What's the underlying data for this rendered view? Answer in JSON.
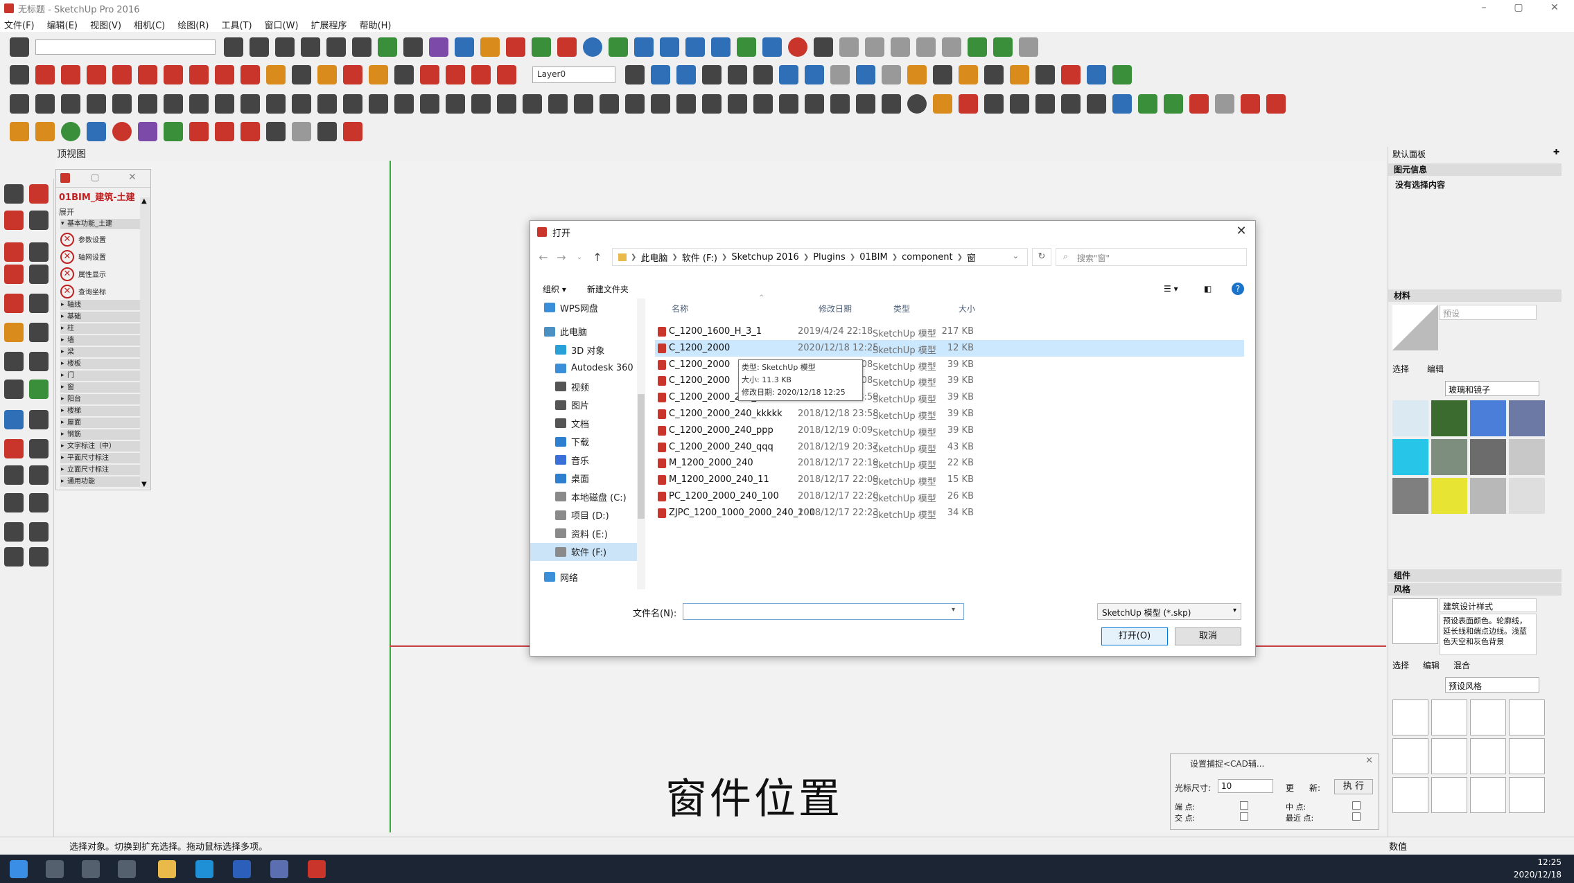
{
  "window": {
    "title": "无标题 - SketchUp Pro 2016"
  },
  "menu": [
    "文件(F)",
    "编辑(E)",
    "视图(V)",
    "相机(C)",
    "绘图(R)",
    "工具(T)",
    "窗口(W)",
    "扩展程序",
    "帮助(H)"
  ],
  "toolbar": {
    "layer_select": "Layer0"
  },
  "view": {
    "label": "顶视图",
    "caption": "窗件位置"
  },
  "plugin_panel": {
    "title": "01BIM_建筑-土建",
    "expand_label": "展开",
    "open_section": "基本功能_土建",
    "items": [
      "参数设置",
      "轴网设置",
      "属性显示",
      "查询坐标"
    ],
    "sections": [
      "轴线",
      "基础",
      "柱",
      "墙",
      "梁",
      "楼板",
      "门",
      "窗",
      "阳台",
      "楼梯",
      "屋面",
      "钢筋",
      "文字标注（中）",
      "平面尺寸标注",
      "立面尺寸标注",
      "通用功能"
    ]
  },
  "dialog": {
    "title": "打开",
    "breadcrumb": [
      "此电脑",
      "软件 (F:)",
      "Sketchup 2016",
      "Plugins",
      "01BIM",
      "component",
      "窗"
    ],
    "search_placeholder": "搜索\"窗\"",
    "organize": "组织 ▾",
    "new_folder": "新建文件夹",
    "nav": [
      {
        "label": "WPS网盘",
        "icon": "cloud-icon"
      },
      {
        "label": "此电脑",
        "icon": "computer-icon"
      },
      {
        "label": "3D 对象",
        "icon": "cube-icon"
      },
      {
        "label": "Autodesk 360",
        "icon": "cloud-icon"
      },
      {
        "label": "视频",
        "icon": "video-icon"
      },
      {
        "label": "图片",
        "icon": "picture-icon"
      },
      {
        "label": "文档",
        "icon": "document-icon"
      },
      {
        "label": "下载",
        "icon": "download-icon"
      },
      {
        "label": "音乐",
        "icon": "music-icon"
      },
      {
        "label": "桌面",
        "icon": "desktop-icon"
      },
      {
        "label": "本地磁盘 (C:)",
        "icon": "drive-icon"
      },
      {
        "label": "项目 (D:)",
        "icon": "drive-icon"
      },
      {
        "label": "资料 (E:)",
        "icon": "drive-icon"
      },
      {
        "label": "软件 (F:)",
        "icon": "drive-icon"
      },
      {
        "label": "网络",
        "icon": "network-icon"
      }
    ],
    "columns": {
      "name": "名称",
      "date": "修改日期",
      "type": "类型",
      "size": "大小"
    },
    "files": [
      {
        "name": "C_1200_1600_H_3_1",
        "date": "2019/4/24 22:18",
        "type": "SketchUp 模型",
        "size": "217 KB"
      },
      {
        "name": "C_1200_2000",
        "date": "2020/12/18 12:25",
        "type": "SketchUp 模型",
        "size": "12 KB"
      },
      {
        "name": "C_1200_2000",
        "date": "2018/12/19 0:08",
        "type": "SketchUp 模型",
        "size": "39 KB"
      },
      {
        "name": "C_1200_2000",
        "date": "2018/12/19 0:08",
        "type": "SketchUp 模型",
        "size": "39 KB"
      },
      {
        "name": "C_1200_2000_240_aaa",
        "date": "2018/12/18 23:59",
        "type": "SketchUp 模型",
        "size": "39 KB"
      },
      {
        "name": "C_1200_2000_240_kkkkk",
        "date": "2018/12/18 23:58",
        "type": "SketchUp 模型",
        "size": "39 KB"
      },
      {
        "name": "C_1200_2000_240_ppp",
        "date": "2018/12/19 0:09",
        "type": "SketchUp 模型",
        "size": "39 KB"
      },
      {
        "name": "C_1200_2000_240_qqq",
        "date": "2018/12/19 20:37",
        "type": "SketchUp 模型",
        "size": "43 KB"
      },
      {
        "name": "M_1200_2000_240",
        "date": "2018/12/17 22:19",
        "type": "SketchUp 模型",
        "size": "22 KB"
      },
      {
        "name": "M_1200_2000_240_11",
        "date": "2018/12/17 22:09",
        "type": "SketchUp 模型",
        "size": "15 KB"
      },
      {
        "name": "PC_1200_2000_240_100",
        "date": "2018/12/17 22:20",
        "type": "SketchUp 模型",
        "size": "26 KB"
      },
      {
        "name": "ZJPC_1200_1000_2000_240_100",
        "date": "2018/12/17 22:23",
        "type": "SketchUp 模型",
        "size": "34 KB"
      }
    ],
    "tooltip": [
      "类型: SketchUp 模型",
      "大小: 11.3 KB",
      "修改日期: 2020/12/18 12:25"
    ],
    "filename_label": "文件名(N):",
    "filename_value": "",
    "filetype": "SketchUp 模型 (*.skp)",
    "open_button": "打开(O)",
    "cancel_button": "取消"
  },
  "tray": {
    "header": "默认面板",
    "entity_info": "图元信息",
    "no_selection": "没有选择内容",
    "materials": "材料",
    "material_name": "预设",
    "select_tab": "选择",
    "edit_tab": "编辑",
    "material_library": "玻璃和镜子",
    "components": "组件",
    "styles": "风格",
    "style_name": "建筑设计样式",
    "style_desc": "预设表面颜色。轮廓线，延长线和端点边线。浅蓝色天空和灰色背景",
    "style_mix_tab": "混合",
    "style_library": "预设风格"
  },
  "snap": {
    "title": "设置捕捉<CAD辅...",
    "cursor_label": "光标尺寸:",
    "cursor_value": "10",
    "update_label": "更",
    "new_label": "新:",
    "exec_button": "执 行",
    "endpoint": "端 点:",
    "midpoint": "中 点:",
    "intersection": "交 点:",
    "nearest": "最近 点:"
  },
  "status": {
    "text": "选择对象。切换到扩充选择。拖动鼠标选择多项。",
    "value_label": "数值"
  },
  "clock": {
    "time": "12:25",
    "date": "2020/12/18"
  },
  "colors": {
    "accent": "#0078d7",
    "sketchup_red": "#c9342b",
    "green_axis": "#39a839",
    "red_axis": "#c94040"
  }
}
